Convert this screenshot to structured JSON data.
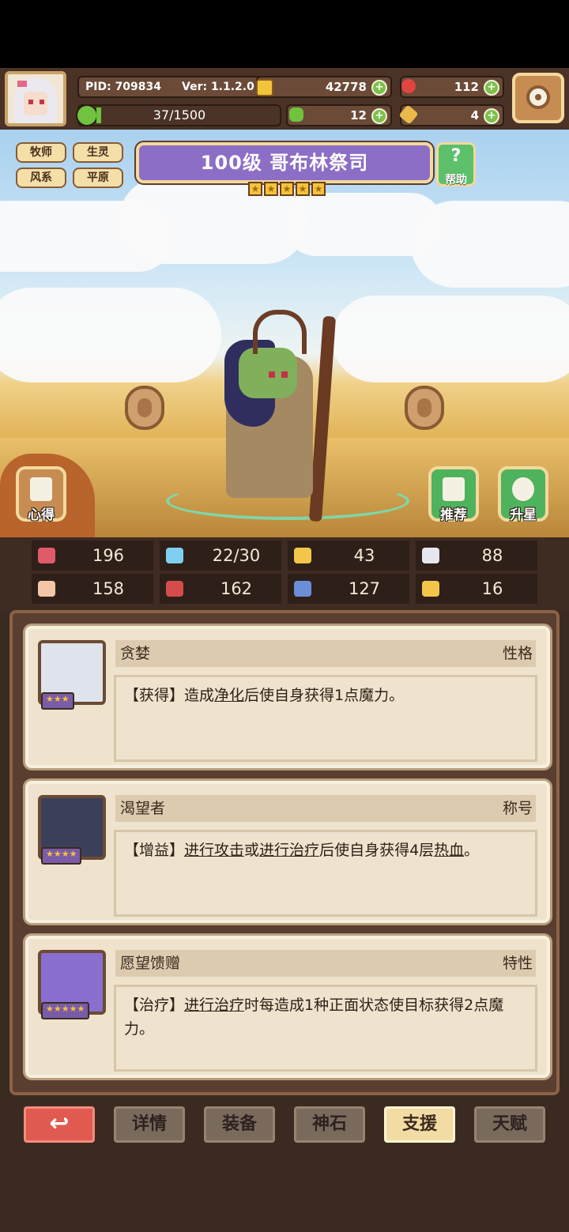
{
  "header": {
    "pid": "PID: 709834",
    "version": "Ver: 1.1.2.0",
    "gold": "42778",
    "gems": "112",
    "xp": "37/1500",
    "clover": "12",
    "keys": "4",
    "xp_fraction": 0.025
  },
  "tags": [
    "牧师",
    "生灵",
    "风系",
    "平原"
  ],
  "title": "100级 哥布林祭司",
  "stars": 5,
  "help_label": "帮助",
  "side": {
    "heart_label": "心得",
    "recommend_label": "推荐",
    "upgrade_label": "升星"
  },
  "stats": [
    {
      "icon": "heart-icon",
      "value": "196",
      "color": "#e05a6a"
    },
    {
      "icon": "drop-icon",
      "value": "22/30",
      "color": "#7fd0f0"
    },
    {
      "icon": "shield-icon",
      "value": "43",
      "color": "#f2c64a"
    },
    {
      "icon": "wing-icon",
      "value": "88",
      "color": "#e6e6ef"
    },
    {
      "icon": "fist-icon",
      "value": "158",
      "color": "#f2c6a6"
    },
    {
      "icon": "book-icon",
      "value": "162",
      "color": "#d54c4c"
    },
    {
      "icon": "scroll-icon",
      "value": "127",
      "color": "#6a8fd8"
    },
    {
      "icon": "magnet-icon",
      "value": "16",
      "color": "#f2c64a"
    }
  ],
  "cards": [
    {
      "name": "贪婪",
      "type": "性格",
      "stars": "★★★",
      "desc_parts": [
        "【获得】造成",
        "净化",
        "后使自身获得1点魔力。"
      ],
      "portrait_color": "#dfe3ec"
    },
    {
      "name": "渴望者",
      "type": "称号",
      "stars": "★★★★",
      "desc_parts": [
        "【增益】",
        "进行攻击",
        "或",
        "进行治疗",
        "后使自身获得4层",
        "热血",
        "。"
      ],
      "portrait_color": "#3c3f5a"
    },
    {
      "name": "愿望馈赠",
      "type": "特性",
      "stars": "★★★★★",
      "desc_parts": [
        "【治疗】",
        "进行治疗",
        "时每造成1种正面状态使目标获得2点魔力。"
      ],
      "portrait_color": "#8a6fd0"
    }
  ],
  "nav": {
    "back": "↩",
    "items": [
      "详情",
      "装备",
      "神石",
      "支援",
      "天赋"
    ],
    "active": "支援"
  }
}
